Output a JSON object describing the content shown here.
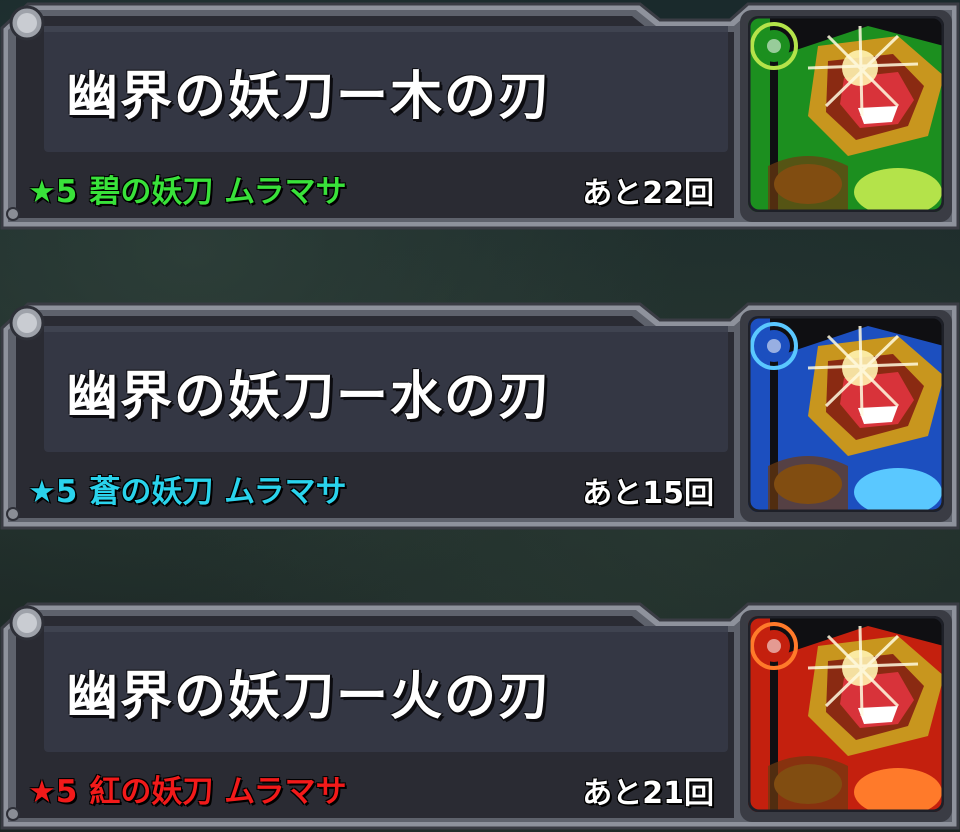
{
  "quests": [
    {
      "title": "幽界の妖刀ー木の刃",
      "reward_rarity": "★5",
      "reward_name": "碧の妖刀 ムラマサ",
      "remaining": "あと22回",
      "element": "wood",
      "element_icon": "wood-element-icon",
      "color": "#39e23a",
      "portrait_main": "#1c8f1f",
      "portrait_accent": "#b4e34a"
    },
    {
      "title": "幽界の妖刀ー水の刃",
      "reward_rarity": "★5",
      "reward_name": "蒼の妖刀 ムラマサ",
      "remaining": "あと15回",
      "element": "water",
      "element_icon": "water-element-icon",
      "color": "#2ad3ec",
      "portrait_main": "#1c4fbf",
      "portrait_accent": "#5ac8ff"
    },
    {
      "title": "幽界の妖刀ー火の刃",
      "reward_rarity": "★5",
      "reward_name": "紅の妖刀 ムラマサ",
      "remaining": "あと21回",
      "element": "fire",
      "element_icon": "fire-element-icon",
      "color": "#f21a1a",
      "portrait_main": "#c4200e",
      "portrait_accent": "#ff7a2a"
    }
  ]
}
